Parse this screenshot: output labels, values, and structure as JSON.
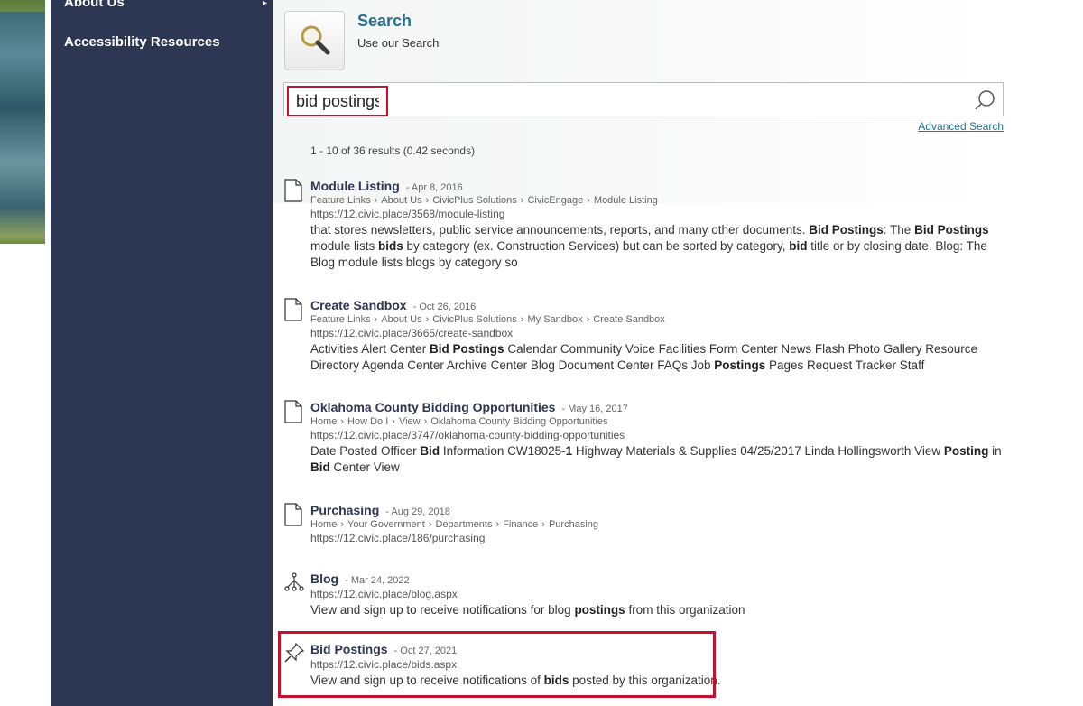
{
  "sidebar": {
    "items": [
      {
        "label": "About Us",
        "arrow": "▸"
      },
      {
        "label": "Accessibility Resources"
      }
    ]
  },
  "header": {
    "title": "Search",
    "subtitle": "Use our Search"
  },
  "search": {
    "value": "bid postings",
    "advanced_label": "Advanced Search",
    "results_count": "1 - 10 of 36 results (0.42 seconds)"
  },
  "results": [
    {
      "icon": "document-icon",
      "title": "Module Listing",
      "date": "- Apr 8, 2016",
      "crumbs": [
        "Feature Links",
        "About Us",
        "CivicPlus Solutions",
        "CivicEngage",
        "Module Listing"
      ],
      "url": "https://12.civic.place/3568/module-listing",
      "snippet": [
        {
          "t": "that stores newsletters, public service announcements, reports, and many other documents. "
        },
        {
          "t": "Bid Postings",
          "b": true
        },
        {
          "t": ": The "
        },
        {
          "t": "Bid Postings",
          "b": true
        },
        {
          "t": " module lists "
        },
        {
          "t": "bids",
          "b": true
        },
        {
          "t": " by category (ex. Construction Services) but can be sorted by category, "
        },
        {
          "t": "bid",
          "b": true
        },
        {
          "t": " title or by closing date. Blog: The Blog module lists blogs by category so"
        }
      ]
    },
    {
      "icon": "document-icon",
      "title": "Create Sandbox",
      "date": "- Oct 26, 2016",
      "crumbs": [
        "Feature Links",
        "About Us",
        "CivicPlus Solutions",
        "My Sandbox",
        "Create Sandbox"
      ],
      "url": "https://12.civic.place/3665/create-sandbox",
      "snippet": [
        {
          "t": "Activities Alert Center "
        },
        {
          "t": "Bid Postings",
          "b": true
        },
        {
          "t": " Calendar Community Voice Facilities Form Center News Flash Photo Gallery Resource Directory Agenda Center Archive Center Blog Document Center FAQs Job "
        },
        {
          "t": "Postings",
          "b": true
        },
        {
          "t": " Pages Request Tracker Staff"
        }
      ]
    },
    {
      "icon": "document-icon",
      "title": "Oklahoma County Bidding Opportunities",
      "date": "- May 16, 2017",
      "crumbs": [
        "Home",
        "How Do I",
        "View",
        "Oklahoma County Bidding Opportunities"
      ],
      "url": "https://12.civic.place/3747/oklahoma-county-bidding-opportunities",
      "snippet": [
        {
          "t": " Date Posted  Officer  "
        },
        {
          "t": "Bid",
          "b": true
        },
        {
          "t": " Information  CW18025-"
        },
        {
          "t": "1",
          "b": true
        },
        {
          "t": " Highway Materials & Supplies  04/25/2017  Linda Hollingsworth View "
        },
        {
          "t": "Posting",
          "b": true
        },
        {
          "t": " in "
        },
        {
          "t": "Bid",
          "b": true
        },
        {
          "t": " Center View"
        }
      ]
    },
    {
      "icon": "document-icon",
      "title": "Purchasing",
      "date": "- Aug 29, 2018",
      "crumbs": [
        "Home",
        "Your Government",
        "Departments",
        "Finance",
        "Purchasing"
      ],
      "url": "https://12.civic.place/186/purchasing",
      "snippet": []
    },
    {
      "icon": "blog-network-icon",
      "title": "Blog",
      "date": "- Mar 24, 2022",
      "crumbs": [],
      "url": "https://12.civic.place/blog.aspx",
      "snippet": [
        {
          "t": "View and sign up to receive notifications for blog "
        },
        {
          "t": "postings",
          "b": true
        },
        {
          "t": " from this organization"
        }
      ]
    },
    {
      "icon": "pushpin-icon",
      "title": "Bid Postings",
      "date": "- Oct 27, 2021",
      "crumbs": [],
      "url": "https://12.civic.place/bids.aspx",
      "snippet": [
        {
          "t": "View and sign up to receive notifications of "
        },
        {
          "t": "bids",
          "b": true
        },
        {
          "t": " posted by this organization."
        }
      ]
    }
  ]
}
